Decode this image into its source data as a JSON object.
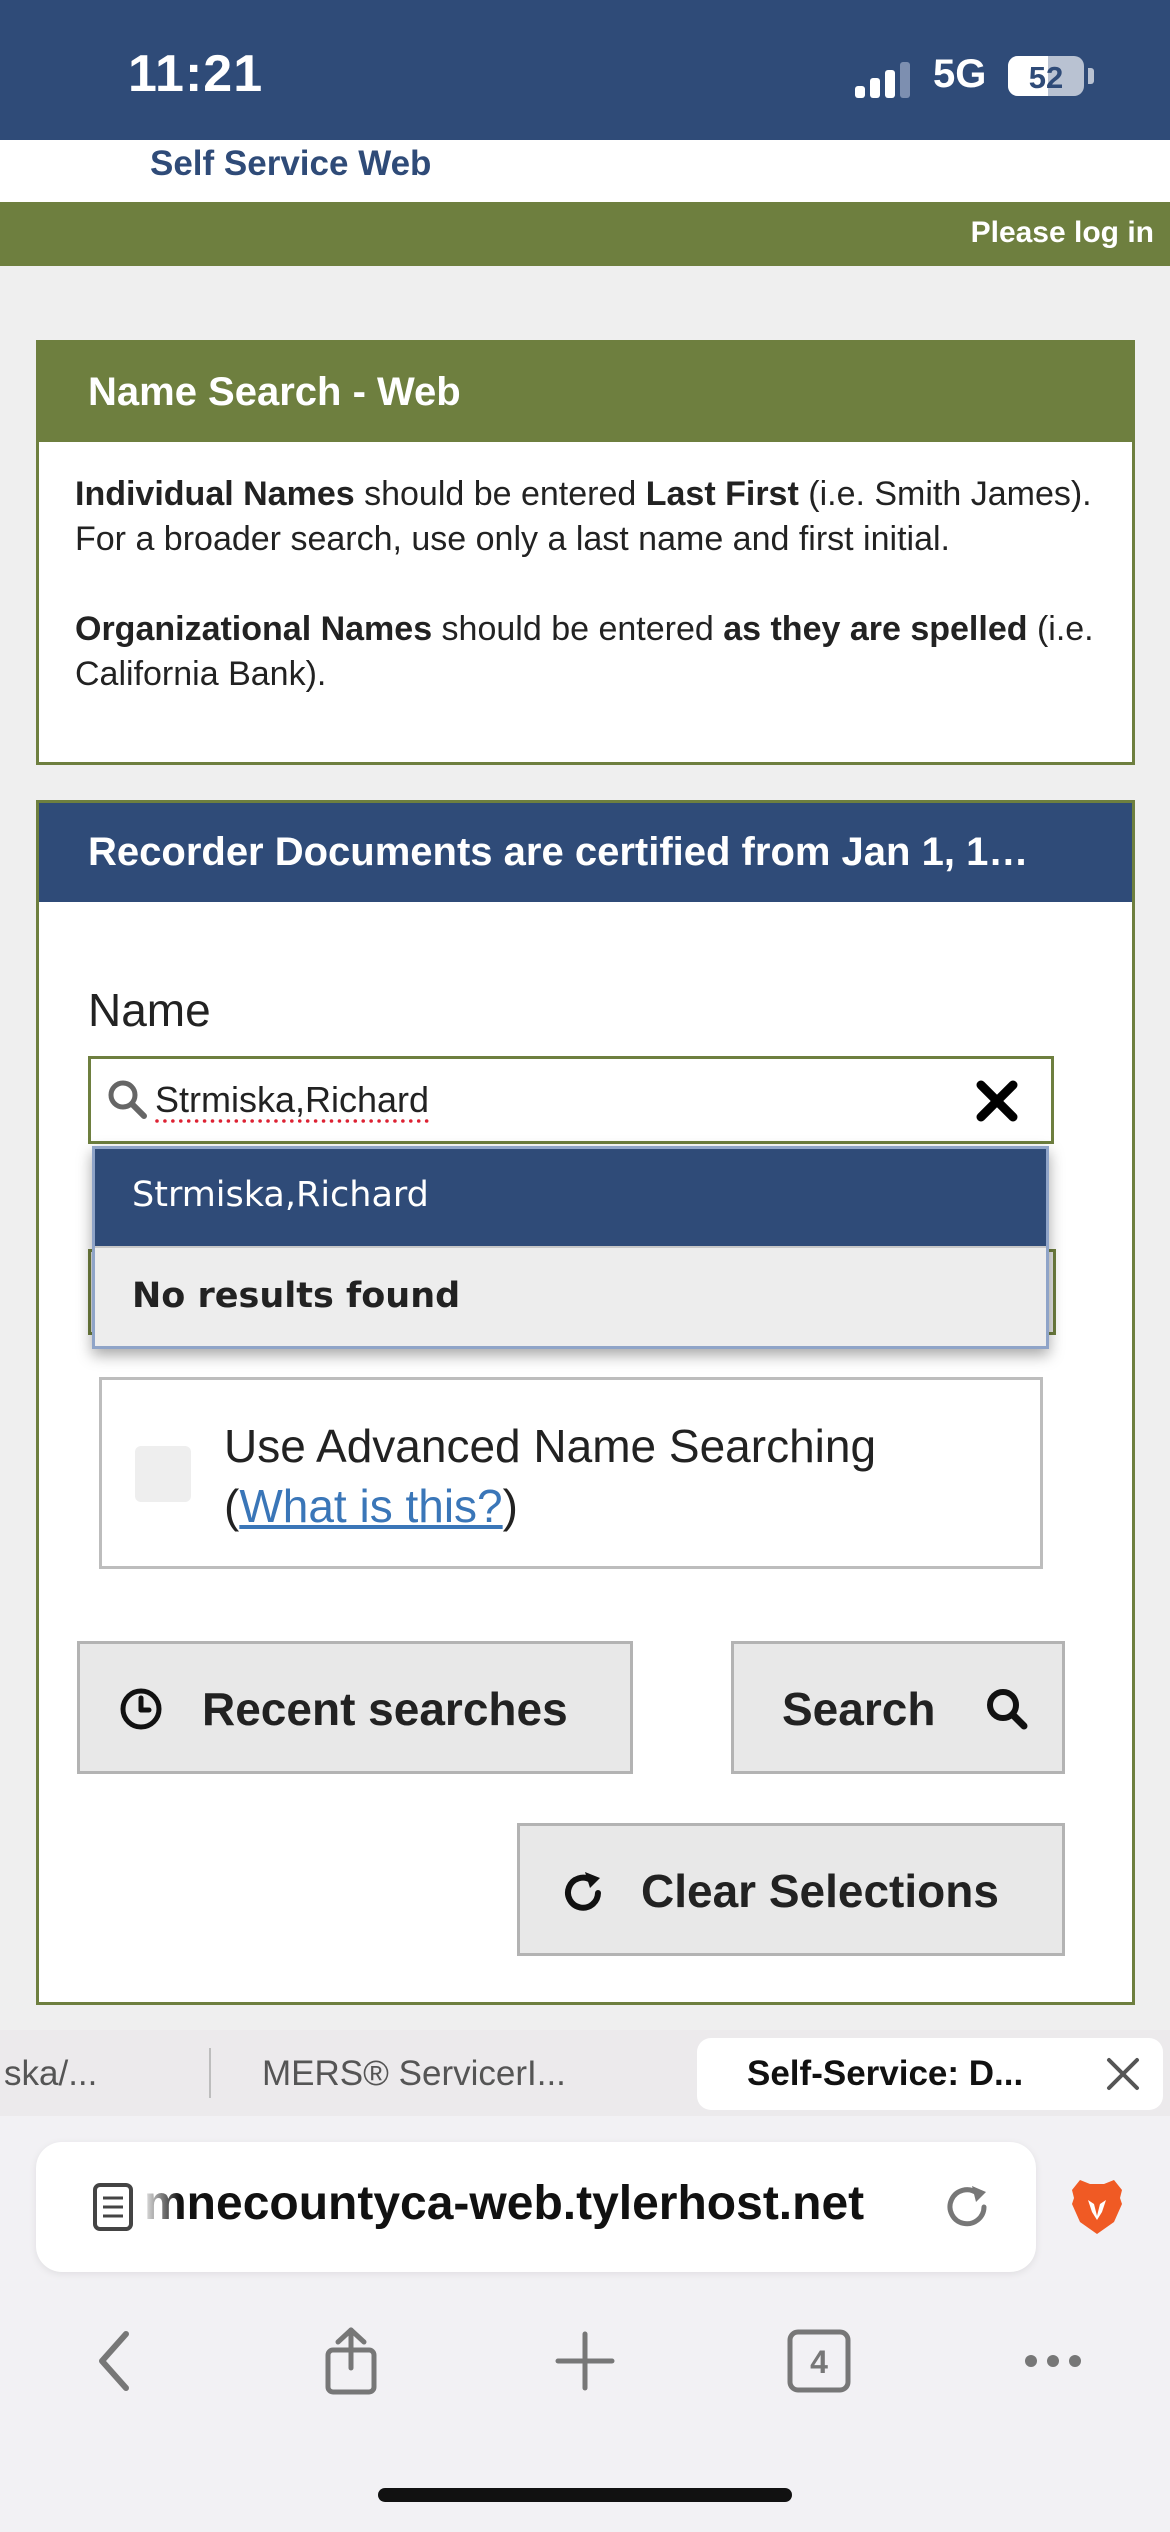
{
  "status_bar": {
    "time": "11:21",
    "network": "5G",
    "battery": "52",
    "battery_level": 0.52
  },
  "header": {
    "site_title": "Self Service Web",
    "login_link": "Please log in"
  },
  "info_panel": {
    "title": "Name Search - Web",
    "p1": {
      "b1": "Individual Names",
      "t1": " should be entered ",
      "b2": "Last First",
      "t2": " (i.e. Smith James). For a broader search, use only a last name and first initial."
    },
    "p2": {
      "b1": "Organizational Names",
      "t1": " should be entered ",
      "b2": "as they are spelled",
      "t2": " (i.e. California Bank)."
    }
  },
  "search_panel": {
    "title": "Recorder Documents are certified from Jan 1, 1…",
    "name_label": "Name",
    "name_value": "Strmiska,Richard",
    "dropdown": {
      "suggestion": "Strmiska,Richard",
      "empty_message": "No results found"
    },
    "advanced": {
      "label": "Use Advanced Name Searching",
      "open_paren": "(",
      "link": "What is this?",
      "close_paren": ")",
      "checked": false
    },
    "buttons": {
      "recent": "Recent searches",
      "search": "Search",
      "clear": "Clear Selections"
    }
  },
  "browser": {
    "tabs": [
      {
        "title": "ska/..."
      },
      {
        "title": "MERS® ServicerI..."
      },
      {
        "title": "Self-Service: D..."
      }
    ],
    "url": "mnecountyca-web.tylerhost.net",
    "tab_count": "4"
  },
  "icons": {
    "search": "search-icon",
    "clear": "close-icon",
    "recent": "clock-icon",
    "refresh": "refresh-icon",
    "back": "chevron-left-icon",
    "share": "share-icon",
    "new_tab": "plus-icon",
    "tabs": "tabs-icon",
    "more": "more-icon",
    "brave": "brave-lion-icon"
  },
  "colors": {
    "navy": "#2f4b78",
    "olive": "#6e7f3f",
    "link": "#3a76b8",
    "brave": "#f05a24"
  }
}
